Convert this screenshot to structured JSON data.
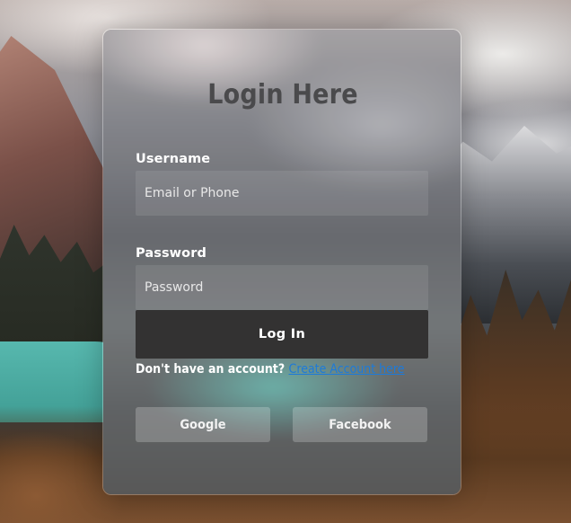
{
  "form": {
    "title": "Login Here",
    "username": {
      "label": "Username",
      "placeholder": "Email or Phone",
      "value": ""
    },
    "password": {
      "label": "Password",
      "placeholder": "Password",
      "value": ""
    },
    "login_button": "Log In",
    "signup": {
      "prompt": "Don't have an account?",
      "link_text": "Create Account here"
    },
    "social": {
      "google": "Google",
      "facebook": "Facebook"
    }
  },
  "colors": {
    "title_text": "#4a4a4c",
    "login_button_bg": "#333232",
    "link": "#1e7ad8",
    "label_text": "#ffffff"
  }
}
